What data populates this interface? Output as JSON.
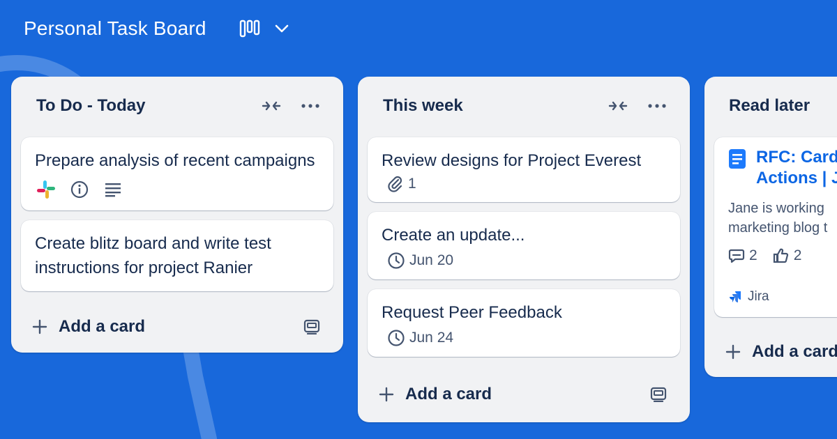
{
  "board": {
    "title": "Personal Task Board",
    "view_icon": "board-view-icon",
    "dropdown_icon": "chevron-down-icon"
  },
  "colors": {
    "background": "#1868DB",
    "list_bg": "#F1F2F4",
    "card_bg": "#FFFFFF",
    "text": "#172B4D",
    "link": "#0C66E4"
  },
  "lists": [
    {
      "title": "To Do - Today",
      "cards": [
        {
          "title": "Prepare analysis of recent campaigns",
          "badges": [
            "slack-icon",
            "info-icon",
            "description-icon"
          ]
        },
        {
          "title": "Create blitz board and write test instructions for project Ranier"
        }
      ],
      "add_card_label": "Add a card"
    },
    {
      "title": "This week",
      "cards": [
        {
          "title": "Review designs for Project Everest",
          "attachments": "1"
        },
        {
          "title": "Create an update...",
          "due": "Jun 20"
        },
        {
          "title": "Request Peer Feedback",
          "due": "Jun 24"
        }
      ],
      "add_card_label": "Add a card"
    },
    {
      "title": "Read later",
      "link_card": {
        "title": "RFC: Card Actions | J",
        "title_line1": "RFC: Card",
        "title_line2": "Actions | J",
        "description": "Jane is working marketing blog t",
        "description_line1": "Jane is working",
        "description_line2": "marketing blog t",
        "comments": "2",
        "likes": "2",
        "source": "Jira"
      },
      "add_card_label": "Add a card"
    }
  ]
}
